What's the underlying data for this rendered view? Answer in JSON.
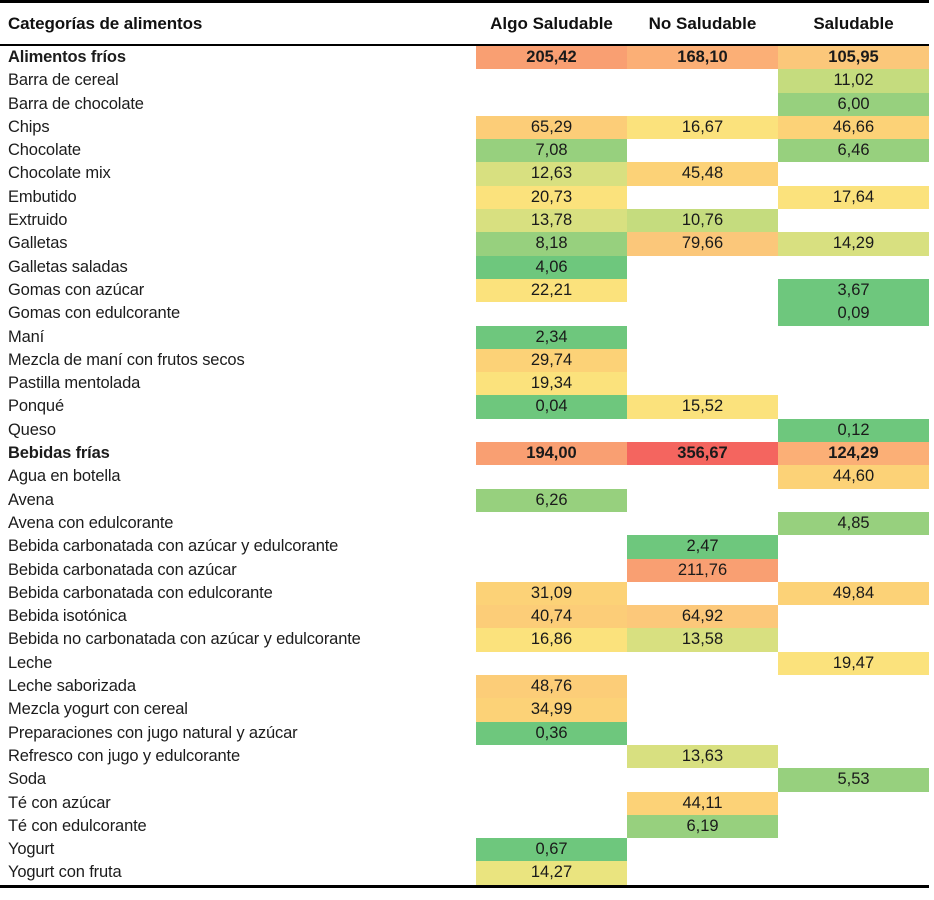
{
  "table": {
    "columns": [
      "Categorías de alimentos",
      "Algo Saludable",
      "No Saludable",
      "Saludable"
    ],
    "colors": {
      "red": "#f4655f",
      "orange_dark": "#f99f72",
      "orange": "#fbaf76",
      "orange_light": "#fbc77a",
      "amber": "#fcd277",
      "yellow": "#fbe27c",
      "yellow_green": "#eae47f",
      "lime": "#d8e080",
      "light_green": "#c5dc7e",
      "green": "#97d07e",
      "green_strong": "#6ec77d",
      "empty": "#ffffff"
    }
  },
  "chart_data": {
    "type": "heatmap",
    "title": "Categorías de alimentos",
    "xlabel": "",
    "ylabel": "",
    "grid": false,
    "legend": "none",
    "categories": [
      "Algo Saludable",
      "No Saludable",
      "Saludable"
    ],
    "rows": [
      {
        "label": "Alimentos fríos",
        "group": true,
        "cells": [
          {
            "value": "205,42",
            "color": "#f99f72"
          },
          {
            "value": "168,10",
            "color": "#fbaf76"
          },
          {
            "value": "105,95",
            "color": "#fbc77a"
          }
        ]
      },
      {
        "label": "Barra de cereal",
        "group": false,
        "cells": [
          {
            "value": "",
            "color": "#ffffff"
          },
          {
            "value": "",
            "color": "#ffffff"
          },
          {
            "value": "11,02",
            "color": "#c5dc7e"
          }
        ]
      },
      {
        "label": "Barra de chocolate",
        "group": false,
        "cells": [
          {
            "value": "",
            "color": "#ffffff"
          },
          {
            "value": "",
            "color": "#ffffff"
          },
          {
            "value": "6,00",
            "color": "#97d07e"
          }
        ]
      },
      {
        "label": "Chips",
        "group": false,
        "cells": [
          {
            "value": "65,29",
            "color": "#fccd78"
          },
          {
            "value": "16,67",
            "color": "#fbe27c"
          },
          {
            "value": "46,66",
            "color": "#fcd277"
          }
        ]
      },
      {
        "label": "Chocolate",
        "group": false,
        "cells": [
          {
            "value": "7,08",
            "color": "#97d07e"
          },
          {
            "value": "",
            "color": "#ffffff"
          },
          {
            "value": "6,46",
            "color": "#97d07e"
          }
        ]
      },
      {
        "label": "Chocolate mix",
        "group": false,
        "cells": [
          {
            "value": "12,63",
            "color": "#d8e080"
          },
          {
            "value": "45,48",
            "color": "#fcd277"
          },
          {
            "value": "",
            "color": "#ffffff"
          }
        ]
      },
      {
        "label": "Embutido",
        "group": false,
        "cells": [
          {
            "value": "20,73",
            "color": "#fbe27c"
          },
          {
            "value": "",
            "color": "#ffffff"
          },
          {
            "value": "17,64",
            "color": "#fbe27c"
          }
        ]
      },
      {
        "label": "Extruido",
        "group": false,
        "cells": [
          {
            "value": "13,78",
            "color": "#d8e080"
          },
          {
            "value": "10,76",
            "color": "#c5dc7e"
          },
          {
            "value": "",
            "color": "#ffffff"
          }
        ]
      },
      {
        "label": "Galletas",
        "group": false,
        "cells": [
          {
            "value": "8,18",
            "color": "#97d07e"
          },
          {
            "value": "79,66",
            "color": "#fbc77a"
          },
          {
            "value": "14,29",
            "color": "#d8e080"
          }
        ]
      },
      {
        "label": "Galletas saladas",
        "group": false,
        "cells": [
          {
            "value": "4,06",
            "color": "#6ec77d"
          },
          {
            "value": "",
            "color": "#ffffff"
          },
          {
            "value": "",
            "color": "#ffffff"
          }
        ]
      },
      {
        "label": "Gomas con azúcar",
        "group": false,
        "cells": [
          {
            "value": "22,21",
            "color": "#fbe27c"
          },
          {
            "value": "",
            "color": "#ffffff"
          },
          {
            "value": "3,67",
            "color": "#6ec77d"
          }
        ]
      },
      {
        "label": "Gomas con edulcorante",
        "group": false,
        "cells": [
          {
            "value": "",
            "color": "#ffffff"
          },
          {
            "value": "",
            "color": "#ffffff"
          },
          {
            "value": "0,09",
            "color": "#6ec77d"
          }
        ]
      },
      {
        "label": "Maní",
        "group": false,
        "cells": [
          {
            "value": "2,34",
            "color": "#6ec77d"
          },
          {
            "value": "",
            "color": "#ffffff"
          },
          {
            "value": "",
            "color": "#ffffff"
          }
        ]
      },
      {
        "label": "Mezcla de maní con frutos secos",
        "group": false,
        "cells": [
          {
            "value": "29,74",
            "color": "#fcd277"
          },
          {
            "value": "",
            "color": "#ffffff"
          },
          {
            "value": "",
            "color": "#ffffff"
          }
        ]
      },
      {
        "label": "Pastilla mentolada",
        "group": false,
        "cells": [
          {
            "value": "19,34",
            "color": "#fbe27c"
          },
          {
            "value": "",
            "color": "#ffffff"
          },
          {
            "value": "",
            "color": "#ffffff"
          }
        ]
      },
      {
        "label": "Ponqué",
        "group": false,
        "cells": [
          {
            "value": "0,04",
            "color": "#6ec77d"
          },
          {
            "value": "15,52",
            "color": "#fbe27c"
          },
          {
            "value": "",
            "color": "#ffffff"
          }
        ]
      },
      {
        "label": "Queso",
        "group": false,
        "cells": [
          {
            "value": "",
            "color": "#ffffff"
          },
          {
            "value": "",
            "color": "#ffffff"
          },
          {
            "value": "0,12",
            "color": "#6ec77d"
          }
        ]
      },
      {
        "label": "Bebidas frías",
        "group": true,
        "cells": [
          {
            "value": "194,00",
            "color": "#f99f72"
          },
          {
            "value": "356,67",
            "color": "#f4655f"
          },
          {
            "value": "124,29",
            "color": "#fbaf76"
          }
        ]
      },
      {
        "label": "Agua en botella",
        "group": false,
        "cells": [
          {
            "value": "",
            "color": "#ffffff"
          },
          {
            "value": "",
            "color": "#ffffff"
          },
          {
            "value": "44,60",
            "color": "#fcd277"
          }
        ]
      },
      {
        "label": "Avena",
        "group": false,
        "cells": [
          {
            "value": "6,26",
            "color": "#97d07e"
          },
          {
            "value": "",
            "color": "#ffffff"
          },
          {
            "value": "",
            "color": "#ffffff"
          }
        ]
      },
      {
        "label": "Avena con edulcorante",
        "group": false,
        "cells": [
          {
            "value": "",
            "color": "#ffffff"
          },
          {
            "value": "",
            "color": "#ffffff"
          },
          {
            "value": "4,85",
            "color": "#97d07e"
          }
        ]
      },
      {
        "label": "Bebida carbonatada con azúcar y edulcorante",
        "group": false,
        "cells": [
          {
            "value": "",
            "color": "#ffffff"
          },
          {
            "value": "2,47",
            "color": "#6ec77d"
          },
          {
            "value": "",
            "color": "#ffffff"
          }
        ]
      },
      {
        "label": "Bebida carbonatada con azúcar",
        "group": false,
        "cells": [
          {
            "value": "",
            "color": "#ffffff"
          },
          {
            "value": "211,76",
            "color": "#f99f72"
          },
          {
            "value": "",
            "color": "#ffffff"
          }
        ]
      },
      {
        "label": "Bebida carbonatada con edulcorante",
        "group": false,
        "cells": [
          {
            "value": "31,09",
            "color": "#fcd277"
          },
          {
            "value": "",
            "color": "#ffffff"
          },
          {
            "value": "49,84",
            "color": "#fcd277"
          }
        ]
      },
      {
        "label": "Bebida isotónica",
        "group": false,
        "cells": [
          {
            "value": "40,74",
            "color": "#fccd78"
          },
          {
            "value": "64,92",
            "color": "#fcc87a"
          },
          {
            "value": "",
            "color": "#ffffff"
          }
        ]
      },
      {
        "label": "Bebida no carbonatada con azúcar y edulcorante",
        "group": false,
        "cells": [
          {
            "value": "16,86",
            "color": "#fbe27c"
          },
          {
            "value": "13,58",
            "color": "#d8e080"
          },
          {
            "value": "",
            "color": "#ffffff"
          }
        ]
      },
      {
        "label": "Leche",
        "group": false,
        "cells": [
          {
            "value": "",
            "color": "#ffffff"
          },
          {
            "value": "",
            "color": "#ffffff"
          },
          {
            "value": "19,47",
            "color": "#fbe27c"
          }
        ]
      },
      {
        "label": "Leche saborizada",
        "group": false,
        "cells": [
          {
            "value": "48,76",
            "color": "#fccd78"
          },
          {
            "value": "",
            "color": "#ffffff"
          },
          {
            "value": "",
            "color": "#ffffff"
          }
        ]
      },
      {
        "label": "Mezcla yogurt con cereal",
        "group": false,
        "cells": [
          {
            "value": "34,99",
            "color": "#fcd277"
          },
          {
            "value": "",
            "color": "#ffffff"
          },
          {
            "value": "",
            "color": "#ffffff"
          }
        ]
      },
      {
        "label": "Preparaciones con jugo natural y azúcar",
        "group": false,
        "cells": [
          {
            "value": "0,36",
            "color": "#6ec77d"
          },
          {
            "value": "",
            "color": "#ffffff"
          },
          {
            "value": "",
            "color": "#ffffff"
          }
        ]
      },
      {
        "label": "Refresco con jugo y edulcorante",
        "group": false,
        "cells": [
          {
            "value": "",
            "color": "#ffffff"
          },
          {
            "value": "13,63",
            "color": "#d8e080"
          },
          {
            "value": "",
            "color": "#ffffff"
          }
        ]
      },
      {
        "label": "Soda",
        "group": false,
        "cells": [
          {
            "value": "",
            "color": "#ffffff"
          },
          {
            "value": "",
            "color": "#ffffff"
          },
          {
            "value": "5,53",
            "color": "#97d07e"
          }
        ]
      },
      {
        "label": "Té con azúcar",
        "group": false,
        "cells": [
          {
            "value": "",
            "color": "#ffffff"
          },
          {
            "value": "44,11",
            "color": "#fcd277"
          },
          {
            "value": "",
            "color": "#ffffff"
          }
        ]
      },
      {
        "label": "Té con edulcorante",
        "group": false,
        "cells": [
          {
            "value": "",
            "color": "#ffffff"
          },
          {
            "value": "6,19",
            "color": "#97d07e"
          },
          {
            "value": "",
            "color": "#ffffff"
          }
        ]
      },
      {
        "label": "Yogurt",
        "group": false,
        "cells": [
          {
            "value": "0,67",
            "color": "#6ec77d"
          },
          {
            "value": "",
            "color": "#ffffff"
          },
          {
            "value": "",
            "color": "#ffffff"
          }
        ]
      },
      {
        "label": "Yogurt con fruta",
        "group": false,
        "cells": [
          {
            "value": "14,27",
            "color": "#eae47f"
          },
          {
            "value": "",
            "color": "#ffffff"
          },
          {
            "value": "",
            "color": "#ffffff"
          }
        ]
      }
    ]
  }
}
